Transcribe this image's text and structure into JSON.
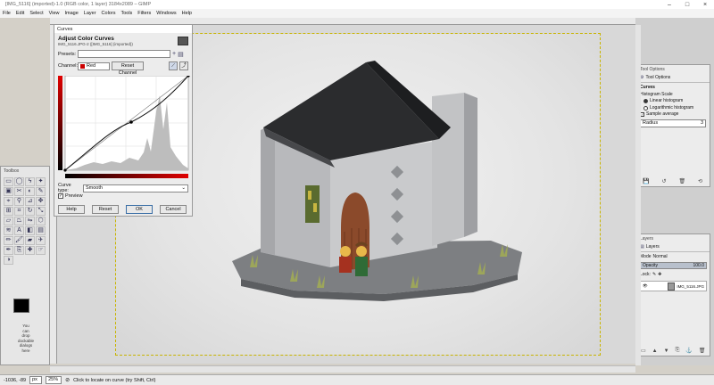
{
  "window": {
    "title": "[IMG_5116] (imported)-1.0 (RGB color, 1 layer) 3184x2089 – GIMP",
    "controls": [
      "–",
      "□",
      "×"
    ]
  },
  "menu": [
    "File",
    "Edit",
    "Select",
    "View",
    "Image",
    "Layer",
    "Colors",
    "Tools",
    "Filters",
    "Windows",
    "Help"
  ],
  "toolbox": {
    "title": "Toolbox",
    "hint": [
      "You",
      "can",
      "drop",
      "dockable",
      "dialogs",
      "here"
    ],
    "fg_color": "#000000",
    "bg_color": "#ffffff"
  },
  "curves": {
    "window_title": "Curves",
    "title": "Adjust Color Curves",
    "subtitle": "IMG_5116.JPG-2 ([IMG_5116] (imported))",
    "presets_label": "Presets:",
    "channel_label": "Channel:",
    "channel_value": "Red",
    "reset_channel": "Reset Channel",
    "curve_type_label": "Curve type:",
    "curve_type_value": "Smooth",
    "preview_label": "Preview",
    "buttons": {
      "help": "Help",
      "reset": "Reset",
      "ok": "OK",
      "cancel": "Cancel"
    },
    "accent": "#b40000"
  },
  "tool_options": {
    "dock_title": "Tool Options",
    "tab_title": "Tool Options",
    "heading": "Curves",
    "histogram_scale": "Histogram Scale",
    "linear": "Linear histogram",
    "logarithmic": "Logarithmic histogram",
    "sample_average": "Sample average",
    "radius_label": "Radius",
    "radius_value": "3"
  },
  "layers": {
    "dock_title": "Layers",
    "tab_title": "Layers",
    "mode_label": "Mode",
    "mode_value": "Normal",
    "opacity_label": "Opacity",
    "opacity_value": "100.0",
    "lock_label": "Lock:",
    "layer_name": "IMG_5116.JPG"
  },
  "status": {
    "coords": "-1036, -89",
    "unit": "px",
    "zoom": "25%",
    "message": "Click to locate on curve (try Shift, Ctrl)"
  }
}
